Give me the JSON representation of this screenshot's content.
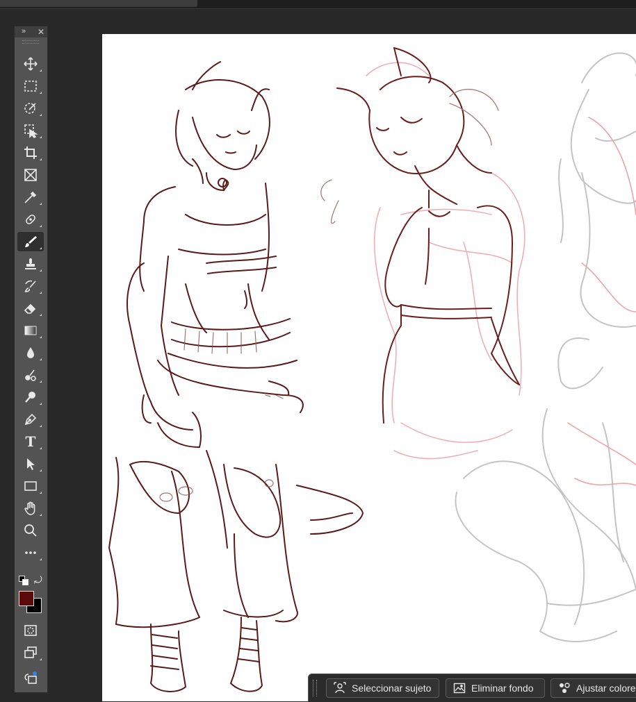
{
  "document_tab": {
    "title": ""
  },
  "toolbar": {
    "tools": [
      {
        "icon": "move-icon"
      },
      {
        "icon": "marquee-icon"
      },
      {
        "icon": "quick-selection-icon"
      },
      {
        "icon": "object-selection-icon"
      },
      {
        "icon": "crop-icon"
      },
      {
        "icon": "frame-icon"
      },
      {
        "icon": "eyedropper-icon"
      },
      {
        "icon": "healing-brush-icon"
      },
      {
        "icon": "brush-icon",
        "active": true
      },
      {
        "icon": "clone-stamp-icon"
      },
      {
        "icon": "history-brush-icon"
      },
      {
        "icon": "eraser-icon"
      },
      {
        "icon": "gradient-icon"
      },
      {
        "icon": "blur-icon"
      },
      {
        "icon": "dodge-icon"
      },
      {
        "icon": "pen-icon"
      },
      {
        "icon": "type-icon",
        "glyph": "T"
      },
      {
        "icon": "path-selection-icon"
      },
      {
        "icon": "rectangle-icon"
      },
      {
        "icon": "hand-icon"
      },
      {
        "icon": "zoom-icon"
      },
      {
        "icon": "more-tools-icon"
      }
    ],
    "foreground_color": "#5c0a0a",
    "background_color": "#000000"
  },
  "contextual_taskbar": {
    "buttons": [
      {
        "label": "Seleccionar sujeto",
        "icon": "select-subject-icon"
      },
      {
        "label": "Eliminar fondo",
        "icon": "remove-background-icon"
      },
      {
        "label": "Ajustar colores",
        "icon": "adjust-colors-icon"
      }
    ]
  },
  "colors": {
    "workspace": "#282828",
    "panel": "#535353",
    "canvas": "#ffffff",
    "sketch_dark": "#5a1a1a",
    "sketch_pink": "#e8a0a6",
    "sketch_grey": "#bdbdbd"
  }
}
